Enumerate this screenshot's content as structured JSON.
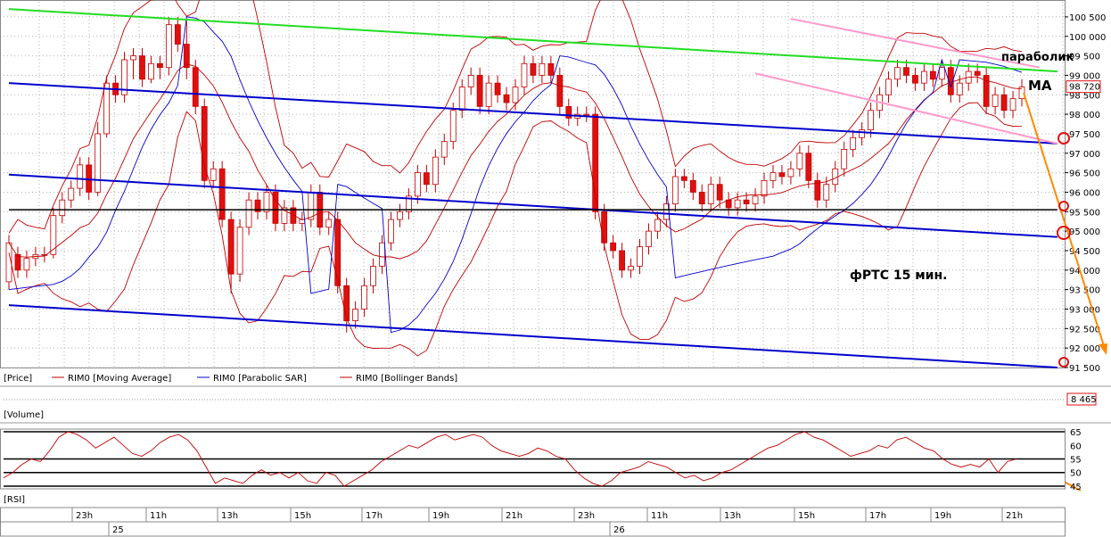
{
  "chart_data": {
    "type": "candlestick",
    "title": "фРТС   15 мин.",
    "annotations": {
      "parabolic": "параболик",
      "ma": "MA",
      "chart_label": "фРТС   15 мин."
    },
    "price_axis": {
      "ylim": [
        91500,
        100750
      ],
      "ticks": [
        100500,
        100000,
        99500,
        99000,
        98500,
        98000,
        97500,
        97000,
        96500,
        96000,
        95500,
        95000,
        94500,
        94000,
        93500,
        93000,
        92500,
        92000,
        91500
      ],
      "tick_labels": [
        "100 500",
        "100 000",
        "99 500",
        "99 000",
        "98 500",
        "98 000",
        "97 500",
        "97 000",
        "96 500",
        "96 000",
        "95 500",
        "95 000",
        "94 500",
        "94 000",
        "93 500",
        "93 000",
        "92 500",
        "92 000",
        "91 500"
      ],
      "last_price": 98720,
      "last_price_label": "98 720"
    },
    "candles": [
      [
        93700,
        94700,
        93500,
        94900
      ],
      [
        94400,
        94000,
        93800,
        94600
      ],
      [
        94000,
        94300,
        93800,
        94500
      ],
      [
        94300,
        94400,
        94100,
        94600
      ],
      [
        94400,
        94400,
        94200,
        94600
      ],
      [
        94400,
        95400,
        94300,
        95600
      ],
      [
        95400,
        95800,
        95200,
        96000
      ],
      [
        95800,
        96100,
        95600,
        96300
      ],
      [
        96100,
        96700,
        95900,
        96900
      ],
      [
        96700,
        96000,
        95800,
        96900
      ],
      [
        96000,
        97500,
        95900,
        97800
      ],
      [
        97500,
        98800,
        97400,
        99000
      ],
      [
        98800,
        98500,
        98300,
        99000
      ],
      [
        98500,
        99400,
        98300,
        99600
      ],
      [
        99400,
        99500,
        98900,
        99700
      ],
      [
        99500,
        98900,
        98700,
        99700
      ],
      [
        98900,
        99300,
        98800,
        99500
      ],
      [
        99300,
        99200,
        98900,
        99500
      ],
      [
        99200,
        100300,
        99000,
        100500
      ],
      [
        100300,
        99800,
        99600,
        100500
      ],
      [
        99800,
        99200,
        98900,
        100400
      ],
      [
        99200,
        98200,
        98000,
        99400
      ],
      [
        98200,
        96300,
        96100,
        98400
      ],
      [
        96300,
        96600,
        96100,
        96800
      ],
      [
        96600,
        95300,
        95100,
        96800
      ],
      [
        95300,
        93900,
        93400,
        95500
      ],
      [
        93900,
        95100,
        93700,
        95300
      ],
      [
        95100,
        95800,
        94900,
        96000
      ],
      [
        95800,
        95500,
        95300,
        96000
      ],
      [
        95500,
        96000,
        95300,
        96200
      ],
      [
        96000,
        95200,
        95000,
        96200
      ],
      [
        95200,
        95600,
        95000,
        95800
      ],
      [
        95600,
        95200,
        95000,
        95800
      ],
      [
        95200,
        95300,
        95000,
        95500
      ],
      [
        95300,
        96000,
        95100,
        96200
      ],
      [
        96000,
        95100,
        94900,
        96200
      ],
      [
        95100,
        95300,
        94900,
        95500
      ],
      [
        95300,
        93600,
        93400,
        95500
      ],
      [
        93600,
        92700,
        92400,
        93800
      ],
      [
        92700,
        93000,
        92500,
        93200
      ],
      [
        93000,
        93600,
        92800,
        93800
      ],
      [
        93600,
        94100,
        93400,
        94300
      ],
      [
        94100,
        94700,
        93900,
        94900
      ],
      [
        94700,
        95300,
        94500,
        95500
      ],
      [
        95300,
        95500,
        95100,
        95700
      ],
      [
        95500,
        95900,
        95300,
        96100
      ],
      [
        95900,
        96500,
        95700,
        96700
      ],
      [
        96500,
        96200,
        96000,
        96700
      ],
      [
        96200,
        96900,
        96000,
        97100
      ],
      [
        96900,
        97300,
        96700,
        97500
      ],
      [
        97300,
        98100,
        97100,
        98300
      ],
      [
        98100,
        98700,
        97900,
        98900
      ],
      [
        98700,
        99000,
        98500,
        99200
      ],
      [
        99000,
        98200,
        98000,
        99200
      ],
      [
        98200,
        98800,
        98000,
        99000
      ],
      [
        98800,
        98500,
        98300,
        99000
      ],
      [
        98500,
        98300,
        98100,
        98700
      ],
      [
        98300,
        98700,
        98100,
        98900
      ],
      [
        98700,
        99300,
        98500,
        99500
      ],
      [
        99300,
        99000,
        98800,
        99500
      ],
      [
        99000,
        99300,
        98800,
        99500
      ],
      [
        99300,
        99000,
        98800,
        99500
      ],
      [
        99000,
        98200,
        98000,
        99200
      ],
      [
        98200,
        97900,
        97700,
        98400
      ],
      [
        97900,
        98000,
        97700,
        98200
      ],
      [
        98000,
        98000,
        97800,
        98200
      ],
      [
        98000,
        95500,
        95300,
        98200
      ],
      [
        95500,
        94700,
        94500,
        95700
      ],
      [
        94700,
        94500,
        94300,
        94900
      ],
      [
        94500,
        94000,
        93800,
        94700
      ],
      [
        94000,
        94100,
        93800,
        94300
      ],
      [
        94100,
        94600,
        93900,
        94800
      ],
      [
        94600,
        95000,
        94400,
        95200
      ],
      [
        95000,
        95300,
        94800,
        95500
      ],
      [
        95300,
        95700,
        95100,
        95900
      ],
      [
        95700,
        96400,
        95500,
        96600
      ],
      [
        96400,
        96300,
        96100,
        96600
      ],
      [
        96300,
        96000,
        95800,
        96500
      ],
      [
        96000,
        95700,
        95500,
        96200
      ],
      [
        95700,
        96200,
        95500,
        96400
      ],
      [
        96200,
        95800,
        95600,
        96400
      ],
      [
        95800,
        95600,
        95400,
        96000
      ],
      [
        95600,
        95800,
        95400,
        96000
      ],
      [
        95800,
        95700,
        95500,
        96000
      ],
      [
        95700,
        95900,
        95500,
        96100
      ],
      [
        95900,
        96300,
        95700,
        96500
      ],
      [
        96300,
        96500,
        96100,
        96700
      ],
      [
        96500,
        96400,
        96200,
        96700
      ],
      [
        96400,
        96600,
        96200,
        96800
      ],
      [
        96600,
        97000,
        96400,
        97200
      ],
      [
        97000,
        96300,
        96100,
        97200
      ],
      [
        96300,
        95800,
        95600,
        96500
      ],
      [
        95800,
        96200,
        95600,
        96400
      ],
      [
        96200,
        96600,
        96000,
        96800
      ],
      [
        96600,
        97100,
        96400,
        97300
      ],
      [
        97100,
        97400,
        96900,
        97600
      ],
      [
        97400,
        97600,
        97200,
        97800
      ],
      [
        97600,
        98100,
        97400,
        98300
      ],
      [
        98100,
        98500,
        97900,
        98700
      ],
      [
        98500,
        98900,
        98300,
        99100
      ],
      [
        98900,
        99200,
        98700,
        99400
      ],
      [
        99200,
        99000,
        98800,
        99400
      ],
      [
        99000,
        98800,
        98600,
        99200
      ],
      [
        98800,
        99100,
        98600,
        99300
      ],
      [
        99100,
        98900,
        98700,
        99300
      ],
      [
        98900,
        99200,
        98700,
        99400
      ],
      [
        99200,
        98500,
        98300,
        99400
      ],
      [
        98500,
        98800,
        98300,
        99000
      ],
      [
        98800,
        99100,
        98600,
        99300
      ],
      [
        99100,
        99000,
        98800,
        99300
      ],
      [
        99000,
        98200,
        98000,
        99200
      ],
      [
        98200,
        98500,
        98000,
        98700
      ],
      [
        98500,
        98100,
        97900,
        98700
      ],
      [
        98100,
        98400,
        97900,
        98600
      ],
      [
        98400,
        98700,
        98200,
        98900
      ]
    ],
    "legend": [
      "[Price]",
      "RIM0 [Moving Average]",
      "RIM0 [Parabolic SAR]",
      "RIM0 [Bollinger Bands]"
    ],
    "volume": {
      "label": "[Volume]",
      "last_value_label": "8 465"
    },
    "rsi": {
      "label": "[RSI]",
      "ylim": [
        44,
        66
      ],
      "ticks": [
        65,
        60,
        55,
        50,
        45
      ],
      "tick_labels": [
        "65",
        "60",
        "55",
        "50",
        "45"
      ],
      "levels": [
        65,
        55,
        50,
        45
      ],
      "values": [
        48,
        50,
        53,
        55,
        54,
        58,
        63,
        65,
        64,
        62,
        59,
        61,
        63,
        60,
        57,
        56,
        58,
        61,
        63,
        64,
        62,
        58,
        52,
        46,
        48,
        47,
        46,
        49,
        51,
        49,
        50,
        48,
        50,
        47,
        46,
        50,
        49,
        45,
        47,
        49,
        51,
        54,
        56,
        58,
        60,
        59,
        61,
        63,
        64,
        62,
        63,
        64,
        63,
        60,
        58,
        57,
        56,
        57,
        59,
        58,
        56,
        55,
        51,
        48,
        46,
        45,
        47,
        50,
        51,
        52,
        54,
        53,
        52,
        50,
        48,
        49,
        47,
        48,
        50,
        51,
        53,
        55,
        57,
        59,
        60,
        62,
        64,
        65,
        63,
        62,
        60,
        58,
        56,
        57,
        58,
        60,
        59,
        62,
        63,
        61,
        59,
        58,
        55,
        53,
        52,
        53,
        52,
        55,
        50,
        54,
        55
      ]
    },
    "time_axis": {
      "hour_labels": [
        "23h",
        "11h",
        "13h",
        "15h",
        "17h",
        "19h",
        "21h",
        "23h",
        "11h",
        "13h",
        "15h",
        "17h",
        "19h",
        "21h"
      ],
      "day_labels": [
        "25",
        "26"
      ]
    },
    "trend_lines": [
      {
        "color": "#22dd22",
        "from": [
          0,
          100700
        ],
        "to": [
          118,
          99100
        ]
      },
      {
        "color": "#0000cc",
        "from": [
          0,
          98800
        ],
        "to": [
          118,
          97250
        ]
      },
      {
        "color": "#0000cc",
        "from": [
          0,
          96450
        ],
        "to": [
          118,
          94850
        ]
      },
      {
        "color": "#0000cc",
        "from": [
          0,
          93100
        ],
        "to": [
          118,
          91500
        ]
      },
      {
        "color": "#000000",
        "from": [
          0,
          95550
        ],
        "to": [
          118,
          95550
        ]
      },
      {
        "color": "#ff99cc",
        "from": [
          88,
          100450
        ],
        "to": [
          116,
          99200
        ]
      },
      {
        "color": "#ff99cc",
        "from": [
          84,
          99050
        ],
        "to": [
          118,
          97250
        ]
      }
    ],
    "colors": {
      "up": "#ffffff",
      "down": "#e01010",
      "candle_outline": "#c00000",
      "ma": "#c00000",
      "sar": "#0000cc",
      "bollinger": "#c00000",
      "green_line": "#22dd22",
      "channel": "#0000cc",
      "pink_channel": "#ff99cc",
      "forecast_arrow": "#ff8800"
    }
  }
}
